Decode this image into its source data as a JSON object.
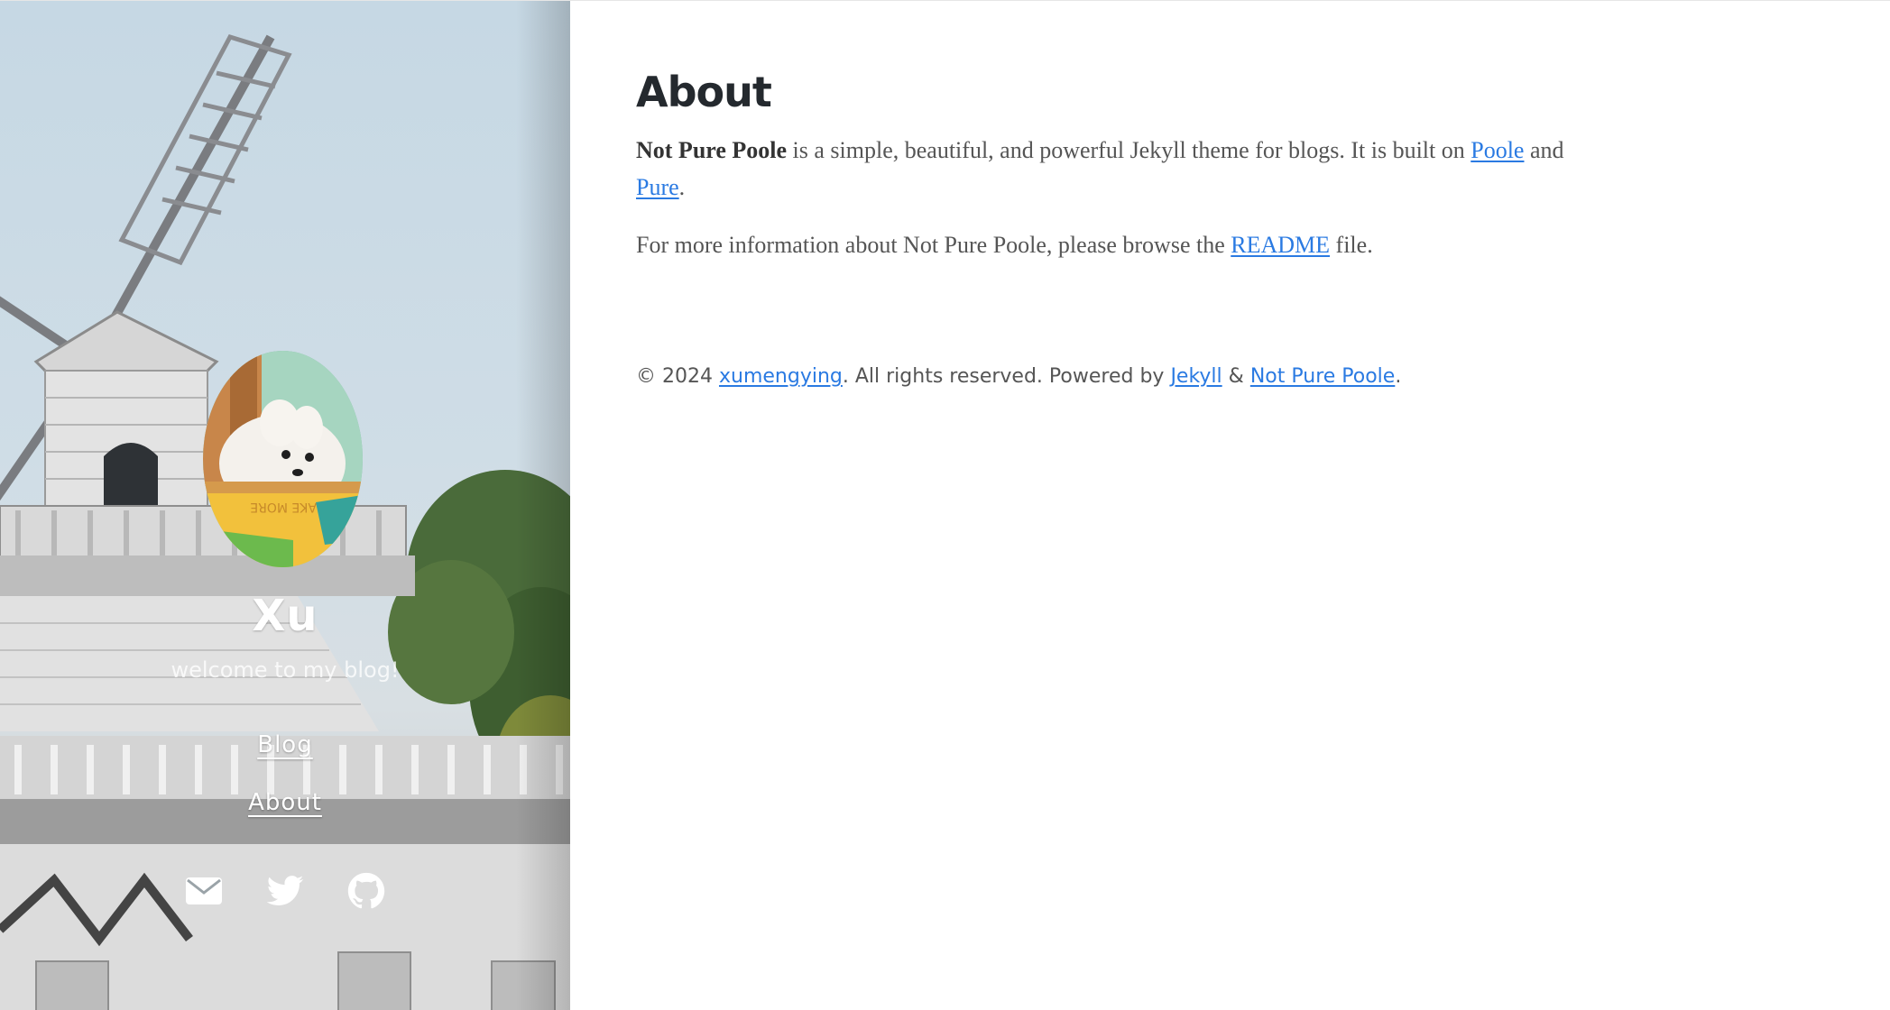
{
  "sidebar": {
    "title": "Xu",
    "subtitle": "welcome to my blog!",
    "nav": [
      {
        "label": "Blog"
      },
      {
        "label": "About"
      }
    ],
    "social": [
      {
        "icon": "envelope-icon"
      },
      {
        "icon": "twitter-icon"
      },
      {
        "icon": "github-icon"
      }
    ]
  },
  "main": {
    "title": "About",
    "p1": {
      "bold": "Not Pure Poole",
      "text1": " is a simple, beautiful, and powerful Jekyll theme for blogs. It is built on ",
      "link1": "Poole",
      "text2": " and ",
      "link2": "Pure",
      "text3": "."
    },
    "p2": {
      "text1": "For more information about Not Pure Poole, please browse the ",
      "link": "README",
      "text2": " file."
    }
  },
  "footer": {
    "copyright": "© 2024 ",
    "author": "xumengying",
    "text1": ". All rights reserved. Powered by ",
    "jekyll": "Jekyll",
    "amp": " & ",
    "theme": "Not Pure Poole",
    "end": "."
  },
  "colors": {
    "link": "#2a7ae2",
    "heading": "#24292e",
    "text": "#555555",
    "sidebar_text": "#ffffff"
  }
}
